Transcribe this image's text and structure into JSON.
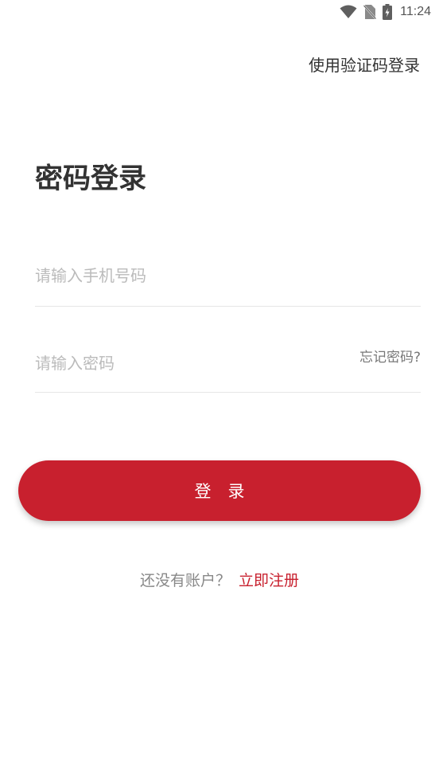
{
  "status_bar": {
    "time": "11:24",
    "icons": [
      "wifi-icon",
      "no-sim-icon",
      "battery-charging-icon"
    ]
  },
  "header": {
    "switch_mode_label": "使用验证码登录"
  },
  "main": {
    "title": "密码登录",
    "phone_placeholder": "请输入手机号码",
    "password_placeholder": "请输入密码",
    "forgot_label": "忘记密码?",
    "login_label": "登　录",
    "register_prompt": "还没有账户？",
    "register_link": "立即注册"
  },
  "colors": {
    "accent": "#c8202e",
    "text": "#333333",
    "placeholder": "#bbbbbb",
    "divider": "#e6e6e6"
  }
}
